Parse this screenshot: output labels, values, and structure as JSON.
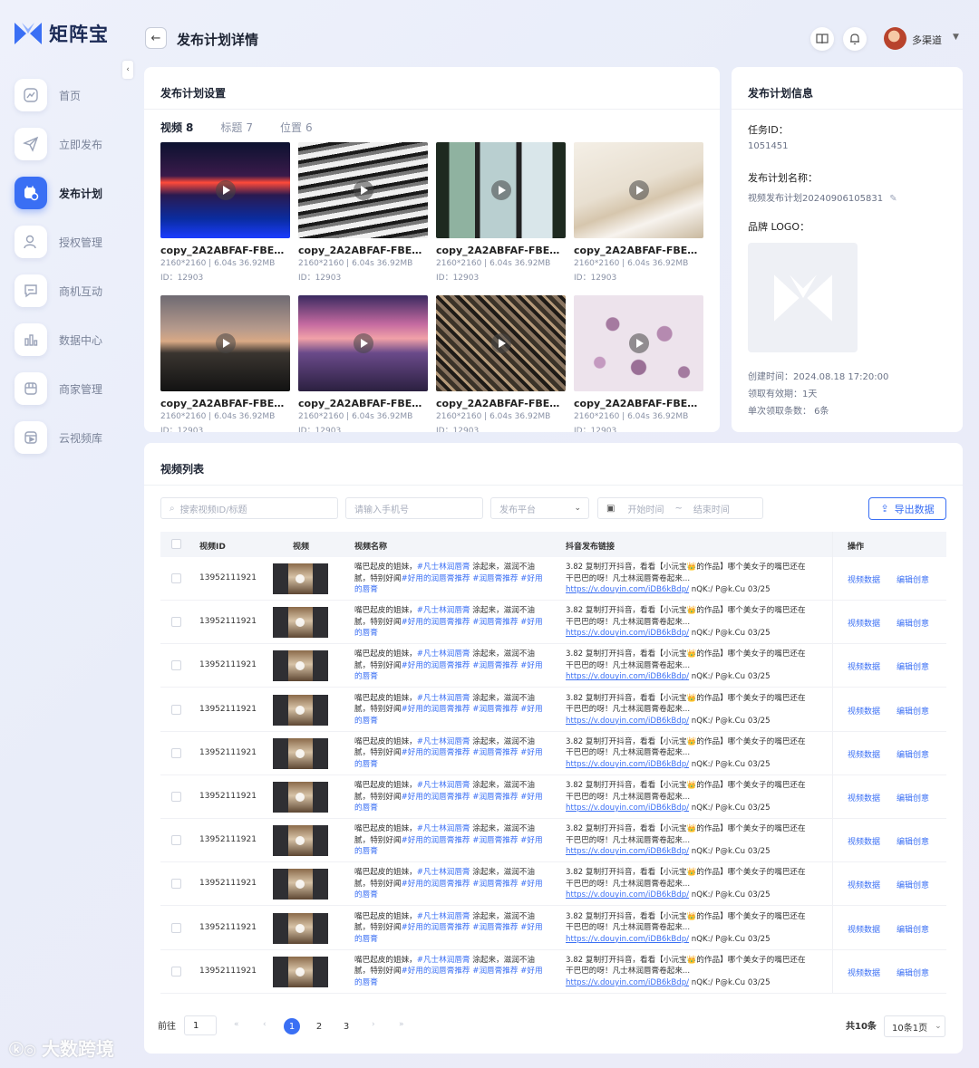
{
  "app": {
    "brand": "矩阵宝",
    "page_title": "发布计划详情"
  },
  "user": {
    "name": "多渠道"
  },
  "sidebar": {
    "items": [
      {
        "label": "首页",
        "icon": "chart-line-icon"
      },
      {
        "label": "立即发布",
        "icon": "send-icon"
      },
      {
        "label": "发布计划",
        "icon": "calendar-clock-icon",
        "active": true
      },
      {
        "label": "授权管理",
        "icon": "user-key-icon"
      },
      {
        "label": "商机互动",
        "icon": "chat-icon"
      },
      {
        "label": "数据中心",
        "icon": "bar-chart-icon"
      },
      {
        "label": "商家管理",
        "icon": "store-icon"
      },
      {
        "label": "云视频库",
        "icon": "video-library-icon"
      }
    ]
  },
  "settings": {
    "title": "发布计划设置",
    "tabs": [
      {
        "label": "视频",
        "count": "8"
      },
      {
        "label": "标题",
        "count": "7"
      },
      {
        "label": "位置",
        "count": "6"
      }
    ],
    "videos": [
      {
        "name": "copy_2A2ABFAF-FBEB-4...",
        "meta": "2160*2160 | 6.04s 36.92MB",
        "id": "ID：12903"
      },
      {
        "name": "copy_2A2ABFAF-FBEB-4...",
        "meta": "2160*2160 | 6.04s 36.92MB",
        "id": "ID：12903"
      },
      {
        "name": "copy_2A2ABFAF-FBEB-4...",
        "meta": "2160*2160 | 6.04s 36.92MB",
        "id": "ID：12903"
      },
      {
        "name": "copy_2A2ABFAF-FBEB-4...",
        "meta": "2160*2160 | 6.04s 36.92MB",
        "id": "ID：12903"
      },
      {
        "name": "copy_2A2ABFAF-FBEB-4...",
        "meta": "2160*2160 | 6.04s 36.92MB",
        "id": "ID：12903"
      },
      {
        "name": "copy_2A2ABFAF-FBEB-4...",
        "meta": "2160*2160 | 6.04s 36.92MB",
        "id": "ID：12903"
      },
      {
        "name": "copy_2A2ABFAF-FBEB-4...",
        "meta": "2160*2160 | 6.04s 36.92MB",
        "id": "ID：12903"
      },
      {
        "name": "copy_2A2ABFAF-FBEB-4...",
        "meta": "2160*2160 | 6.04s 36.92MB",
        "id": "ID：12903"
      }
    ]
  },
  "info": {
    "title": "发布计划信息",
    "task_id_label": "任务ID：",
    "task_id": "1051451",
    "plan_name_label": "发布计划名称：",
    "plan_name": "视频发布计划20240906105831",
    "brand_logo_label": "品牌 LOGO：",
    "created": "创建时间：2024.08.18  17:20:00",
    "validity": "领取有效期：1天",
    "per_claim": "单次领取条数：  6条"
  },
  "list": {
    "title": "视频列表",
    "search_placeholder": "搜索视频ID/标题",
    "phone_placeholder": "请输入手机号",
    "platform_placeholder": "发布平台",
    "start_placeholder": "开始时间",
    "end_placeholder": "结束时间",
    "range_sep": "~",
    "export_label": "导出数据",
    "columns": [
      "视频ID",
      "视频",
      "视频名称",
      "抖音发布链接",
      "操作"
    ],
    "row": {
      "id": "13952111921",
      "name_a": "嘴巴起皮的姐妹，",
      "name_tag1": "#凡士林润唇膏",
      "name_b": " 涂起来，滋润不油腻，特别好闻",
      "name_tag2": "#好用的润唇膏推荐 #润唇膏推荐 #好用的唇膏",
      "link_a": "3.82 复制打开抖音，看看【小沅宝",
      "link_crown": "👑",
      "link_b": "的作品】哪个美女子的嘴巴还在干巴巴的呀！凡士林润唇膏卷起来... ",
      "link_url": "https://v.douyin.com/iDB6kBdp/",
      "link_c": " nQK:/ P@k.Cu 03/25",
      "op_data": "视频数据",
      "op_edit": "编辑创意"
    },
    "row_count": 10
  },
  "pagination": {
    "goto_label": "前往",
    "goto_value": "1",
    "first": "«",
    "prev": "‹",
    "pages": [
      "1",
      "2",
      "3"
    ],
    "current": "1",
    "next": "›",
    "last": "»",
    "total": "共10条",
    "page_size": "10条1页"
  },
  "watermark": {
    "text": "大数跨境"
  },
  "colors": {
    "accent": "#3a6ff4",
    "brand": "#1b2a55"
  }
}
